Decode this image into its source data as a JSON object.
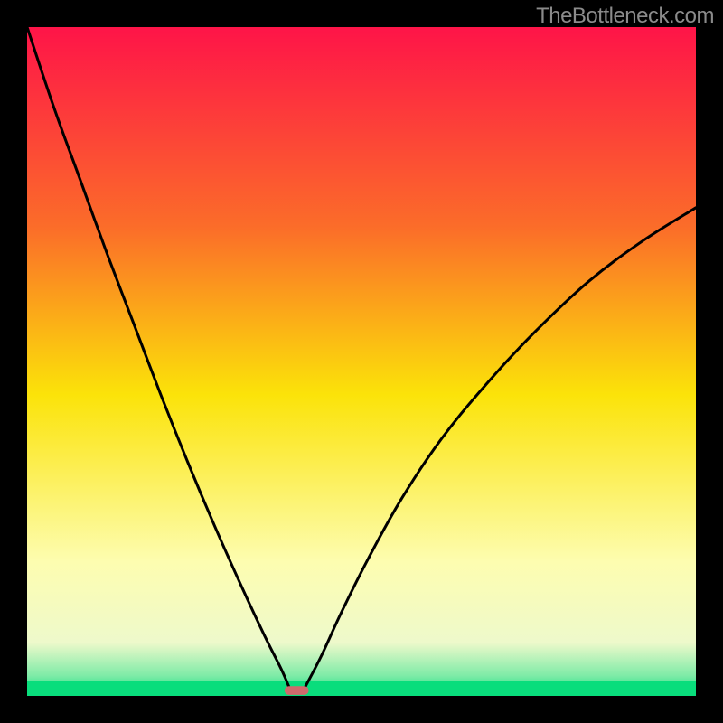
{
  "watermark": "TheBottleneck.com",
  "chart_data": {
    "type": "line",
    "title": "",
    "xlabel": "",
    "ylabel": "",
    "xlim": [
      0,
      1
    ],
    "ylim": [
      0,
      1
    ],
    "legend": false,
    "grid": false,
    "background_gradient": {
      "stops": [
        {
          "offset": 0.0,
          "color": "#fe1448"
        },
        {
          "offset": 0.3,
          "color": "#fb6d29"
        },
        {
          "offset": 0.55,
          "color": "#fbe309"
        },
        {
          "offset": 0.8,
          "color": "#fdfdb0"
        },
        {
          "offset": 0.92,
          "color": "#eef9cb"
        },
        {
          "offset": 0.97,
          "color": "#7eeba7"
        },
        {
          "offset": 1.0,
          "color": "#09dd7c"
        }
      ]
    },
    "bottom_band": {
      "color": "#09dd7c",
      "height_fraction": 0.022
    },
    "axes_visible": false,
    "curves_note": "Two monotone curves meeting near x≈0.39 at y≈0 (V shape). Left curve starts at (0,1) and descends; right curve rises toward (1, ~0.73).",
    "series": [
      {
        "name": "left-curve",
        "x": [
          0.0,
          0.04,
          0.08,
          0.12,
          0.16,
          0.2,
          0.24,
          0.28,
          0.32,
          0.355,
          0.38,
          0.393
        ],
        "y": [
          1.0,
          0.88,
          0.77,
          0.66,
          0.555,
          0.45,
          0.35,
          0.255,
          0.165,
          0.09,
          0.04,
          0.01
        ]
      },
      {
        "name": "right-curve",
        "x": [
          0.414,
          0.44,
          0.47,
          0.51,
          0.56,
          0.62,
          0.69,
          0.76,
          0.84,
          0.92,
          1.0
        ],
        "y": [
          0.01,
          0.06,
          0.125,
          0.205,
          0.295,
          0.385,
          0.47,
          0.545,
          0.62,
          0.68,
          0.73
        ]
      }
    ],
    "trough_marker": {
      "x_center": 0.403,
      "x_halfwidth": 0.018,
      "y": 0.008,
      "height": 0.013,
      "fill": "#cf6a6c"
    }
  }
}
